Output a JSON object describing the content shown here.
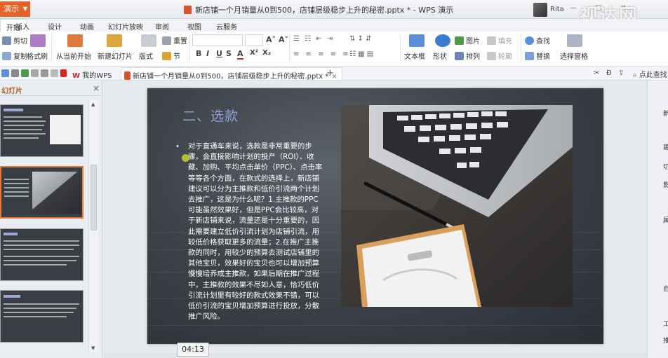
{
  "titlebar": {
    "app_button": "演示",
    "document_title": "新店铺一个月销量从0到500，店铺层级稳步上升的秘密.pptx * - WPS 演示",
    "user_name": "Rita",
    "watermark": "视达网"
  },
  "menu": {
    "tabs": [
      "开始",
      "插入",
      "设计",
      "动画",
      "幻灯片放映",
      "审阅",
      "视图",
      "云服务"
    ],
    "active": "开始"
  },
  "ribbon": {
    "cut": "剪切",
    "copy": "复制",
    "format_painter": "格式刷",
    "play_from_current": "从当前开始",
    "new_slide": "新建幻灯片",
    "layout": "版式",
    "reset": "重置",
    "section": "节",
    "textbox": "文本框",
    "shapes": "形状",
    "picture": "图片",
    "fill": "填充",
    "arrange": "排列",
    "outline": "轮廓",
    "find": "查找",
    "replace": "替换",
    "selection_pane": "选择窗格",
    "format_buttons": [
      "B",
      "I",
      "U",
      "S",
      "A",
      "X²",
      "X₂"
    ]
  },
  "quickbar": {
    "tabs": [
      {
        "label": "我的WPS"
      },
      {
        "label": "新店铺一个月销量从0到500，店铺层级稳步上升的秘密.pptx *"
      }
    ],
    "search_hint": "点此查找"
  },
  "left_pane": {
    "title": "幻灯片",
    "close": "×"
  },
  "slide": {
    "title": "二、选款",
    "bullet": "•",
    "body": "对于直通车来说，选款是非常重要的步骤，会直接影响计划的投产（ROI）、收藏、加购、平均点击单价（PPC）、点击率等等各个方面，在款式的选择上，新店铺建议可以分为主推款和低价引流两个计划去推广，这是为什么呢？1.主推款的PPC可能虽然效果好，但是PPC会比较高，对于新店铺来说，流量还是十分重要的，因此需要建立低价引流计划为店铺引流，用较低价格获取更多的流量；2.在推广主推款的同时，用较少的预算去测试店铺里的其他宝贝，效果好的宝贝也可以增加预算慢慢培养成主推款，如果后期在推广过程中，主推款的效果不尽如人意，恰巧低价引流计划里有较好的款式效果不错，可以低价引流的宝贝增加预算进行投放，分散推广风险。"
  },
  "right_bar": {
    "chars": [
      "新",
      "建",
      "切",
      "影",
      "属",
      "自",
      "工",
      "推"
    ]
  },
  "video": {
    "timestamp": "04:13"
  },
  "colors": {
    "accent": "#e2642b",
    "slide_title": "#8b9fd4",
    "selection": "#e57a34"
  }
}
